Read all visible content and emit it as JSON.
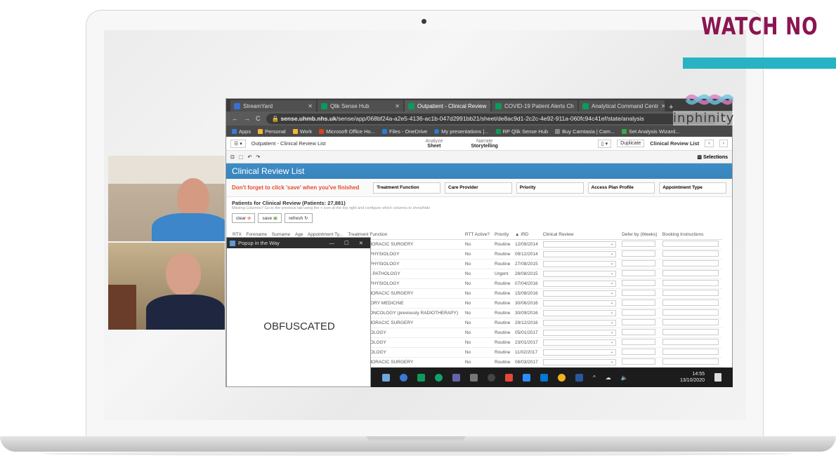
{
  "overlay": {
    "watch_text": "WATCH NO",
    "logo_text": "inphinity",
    "teal": "#27b3c3",
    "magenta": "#8b1550"
  },
  "browser": {
    "tabs": [
      {
        "label": "StreamYard",
        "icon": "streamyard-icon"
      },
      {
        "label": "Qlik Sense Hub",
        "icon": "qlik-icon"
      },
      {
        "label": "Outpatient - Clinical Review",
        "icon": "qlik-icon"
      },
      {
        "label": "COVID-19 Patient Alerts Ch",
        "icon": "qlik-icon"
      },
      {
        "label": "Analytical Command Centr",
        "icon": "qlik-icon"
      }
    ],
    "url_host": "sense.uhmb.nhs.uk",
    "url_path": "/sense/app/068bf24a-a2e5-4136-ac1b-047d2991bb21/sheet/de8ac9d1-2c2c-4e92-911a-060fc94c41ef/state/analysis",
    "bookmarks": [
      "Apps",
      "Personal",
      "Work",
      "Microsoft Office Ho...",
      "Files - OneDrive",
      "My presentations |...",
      "RP Qlik Sense Hub",
      "Buy Camtasia | Cam...",
      "Set Analysis Wizard..."
    ]
  },
  "qlik": {
    "app_title": "Outpatient - Clinical Review List",
    "analyze_label": "Analyze",
    "sheet_label": "Sheet",
    "narrate_label": "Narrate",
    "storytelling_label": "Storytelling",
    "duplicate_label": "Duplicate",
    "sheet_name": "Clinical Review List",
    "selections_label": "Selections",
    "page_title": "Clinical Review List",
    "warning": "Don't forget to click 'save' when you've finished",
    "filters": [
      "Treatment Function",
      "Care Provider",
      "Priority",
      "Access Plan Profile",
      "Appointment Type"
    ],
    "patients_label": "Patients for Clinical Review (Patients: 27,881)",
    "hint": "Missing Columns? Go to the previous tab using the < icon at the top right and configure which columns to show/hide",
    "clear_label": "clear",
    "save_label": "save",
    "refresh_label": "refresh"
  },
  "table": {
    "headers": [
      "RTX",
      "Forename",
      "Surname",
      "Age",
      "Appointment Ty...",
      "Treatment Function",
      "RTT Active?",
      "Priority",
      "▲ IRD",
      "Clinical Review",
      "Defer by (Weeks)",
      "Booking Instructions"
    ],
    "rows": [
      {
        "tf": "CARDIOTHORACIC SURGERY",
        "rtt": "No",
        "pri": "Routine",
        "ird": "12/09/2014"
      },
      {
        "tf": "CLINICAL PHYSIOLOGY",
        "rtt": "No",
        "pri": "Routine",
        "ird": "09/12/2014"
      },
      {
        "tf": "CLINICAL PHYSIOLOGY",
        "rtt": "No",
        "pri": "Routine",
        "ird": "27/08/2015"
      },
      {
        "tf": "CHEMICAL PATHOLOGY",
        "rtt": "No",
        "pri": "Urgent",
        "ird": "28/08/2015"
      },
      {
        "tf": "CLINICAL PHYSIOLOGY",
        "rtt": "No",
        "pri": "Routine",
        "ird": "07/04/2016"
      },
      {
        "tf": "CARDIOTHORACIC SURGERY",
        "rtt": "No",
        "pri": "Routine",
        "ird": "15/08/2016"
      },
      {
        "tf": "RESPIRATORY MEDICINE",
        "rtt": "No",
        "pri": "Routine",
        "ird": "30/06/2016"
      },
      {
        "tf": "CLINICAL ONCOLOGY (previously RADIOTHERAPY)",
        "rtt": "No",
        "pri": "Routine",
        "ird": "30/09/2016"
      },
      {
        "tf": "CARDIOTHORACIC SURGERY",
        "rtt": "No",
        "pri": "Routine",
        "ird": "29/12/2016"
      },
      {
        "tf": "RHEUMATOLOGY",
        "rtt": "No",
        "pri": "Routine",
        "ird": "05/01/2017"
      },
      {
        "tf": "RHEUMATOLOGY",
        "rtt": "No",
        "pri": "Routine",
        "ird": "23/01/2017"
      },
      {
        "tf": "RHEUMATOLOGY",
        "rtt": "No",
        "pri": "Routine",
        "ird": "11/02/2017"
      },
      {
        "tf": "CARDIOTHORACIC SURGERY",
        "rtt": "No",
        "pri": "Routine",
        "ird": "08/03/2017"
      }
    ]
  },
  "popup": {
    "title": "Popup in the Way",
    "body": "OBFUSCATED"
  },
  "taskbar": {
    "time": "14:55",
    "date": "13/10/2020"
  }
}
